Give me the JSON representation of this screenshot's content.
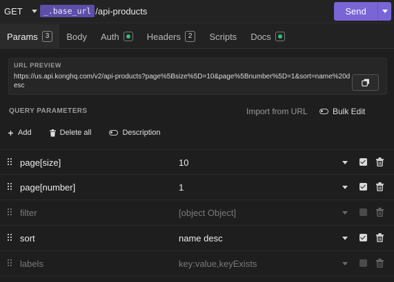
{
  "request": {
    "method": "GET",
    "url_variable": "_.base_url",
    "url_path": "/api-products",
    "send_label": "Send"
  },
  "tabs": [
    {
      "label": "Params",
      "count": "3",
      "active": true
    },
    {
      "label": "Body"
    },
    {
      "label": "Auth",
      "dot": true
    },
    {
      "label": "Headers",
      "count": "2"
    },
    {
      "label": "Scripts"
    },
    {
      "label": "Docs",
      "dot": true
    }
  ],
  "preview": {
    "title": "URL PREVIEW",
    "text": "https://us.api.konghq.com/v2/api-products?page%5Bsize%5D=10&page%5Bnumber%5D=1&sort=name%20desc"
  },
  "query": {
    "title": "QUERY PARAMETERS",
    "import_label": "Import from URL",
    "bulk_edit_label": "Bulk Edit",
    "add_label": "Add",
    "delete_all_label": "Delete all",
    "description_label": "Description"
  },
  "params": [
    {
      "name": "page[size]",
      "value": "10",
      "enabled": true
    },
    {
      "name": "page[number]",
      "value": "1",
      "enabled": true
    },
    {
      "name": "filter",
      "value": "[object Object]",
      "enabled": false
    },
    {
      "name": "sort",
      "value": "name desc",
      "enabled": true
    },
    {
      "name": "labels",
      "value": "key:value,keyExists",
      "enabled": false
    }
  ],
  "colors": {
    "send": "#7a65d6",
    "variable_chip": "#5d4fa8",
    "status_dot": "#2ec27e",
    "background": "#1e1e1e"
  }
}
